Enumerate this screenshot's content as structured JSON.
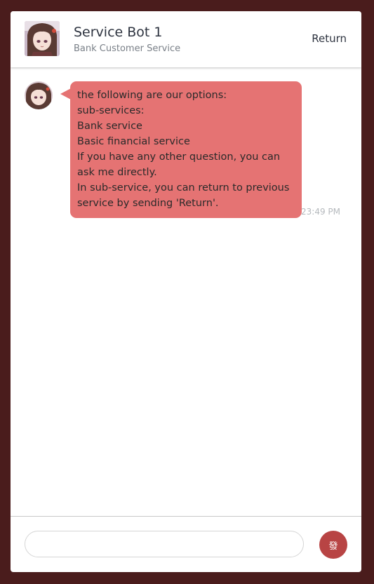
{
  "header": {
    "bot_name": "Service Bot 1",
    "bot_subtitle": "Bank Customer Service",
    "return_label": "Return"
  },
  "messages": [
    {
      "sender": "bot",
      "lines": [
        "the following are our options:",
        "sub-services:",
        "Bank service",
        "Basic financial service",
        "If you have any other question, you can",
        "ask me directly.",
        "In sub-service, you can return to previous",
        "service by sending 'Return'."
      ],
      "time": "23:49 PM"
    }
  ],
  "composer": {
    "input_value": "",
    "placeholder": "",
    "send_label": "發"
  },
  "colors": {
    "page_background": "#4a1c1c",
    "bubble": "#e57373",
    "send_button": "#b84444",
    "timestamp": "#b5b9bd"
  },
  "icons": {
    "header_avatar": "bot-avatar-icon",
    "message_avatar": "bot-avatar-icon"
  }
}
